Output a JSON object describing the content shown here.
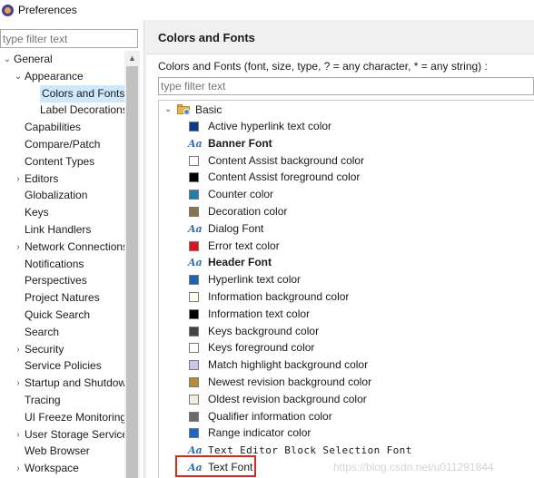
{
  "window": {
    "title": "Preferences"
  },
  "left": {
    "filter_placeholder": "type filter text",
    "tree": [
      {
        "label": "General",
        "arrow": "⌄",
        "level": 0
      },
      {
        "label": "Appearance",
        "arrow": "⌄",
        "level": 1
      },
      {
        "label": "Colors and Fonts",
        "arrow": "",
        "level": 2,
        "selected": true
      },
      {
        "label": "Label Decorations",
        "arrow": "",
        "level": 2
      },
      {
        "label": "Capabilities",
        "arrow": "",
        "level": 1
      },
      {
        "label": "Compare/Patch",
        "arrow": "",
        "level": 1
      },
      {
        "label": "Content Types",
        "arrow": "",
        "level": 1
      },
      {
        "label": "Editors",
        "arrow": "›",
        "level": 1
      },
      {
        "label": "Globalization",
        "arrow": "",
        "level": 1
      },
      {
        "label": "Keys",
        "arrow": "",
        "level": 1
      },
      {
        "label": "Link Handlers",
        "arrow": "",
        "level": 1
      },
      {
        "label": "Network Connections",
        "arrow": "›",
        "level": 1
      },
      {
        "label": "Notifications",
        "arrow": "",
        "level": 1
      },
      {
        "label": "Perspectives",
        "arrow": "",
        "level": 1
      },
      {
        "label": "Project Natures",
        "arrow": "",
        "level": 1
      },
      {
        "label": "Quick Search",
        "arrow": "",
        "level": 1
      },
      {
        "label": "Search",
        "arrow": "",
        "level": 1
      },
      {
        "label": "Security",
        "arrow": "›",
        "level": 1
      },
      {
        "label": "Service Policies",
        "arrow": "",
        "level": 1
      },
      {
        "label": "Startup and Shutdown",
        "arrow": "›",
        "level": 1
      },
      {
        "label": "Tracing",
        "arrow": "",
        "level": 1
      },
      {
        "label": "UI Freeze Monitoring",
        "arrow": "",
        "level": 1
      },
      {
        "label": "User Storage Service",
        "arrow": "›",
        "level": 1
      },
      {
        "label": "Web Browser",
        "arrow": "",
        "level": 1
      },
      {
        "label": "Workspace",
        "arrow": "›",
        "level": 1
      }
    ]
  },
  "right": {
    "title": "Colors and Fonts",
    "description": "Colors and Fonts (font, size, type, ? = any character, * = any string) :",
    "filter_placeholder": "type filter text",
    "category": {
      "label": "Basic",
      "icon": "folder-icon"
    },
    "items": [
      {
        "label": "Active hyperlink text color",
        "kind": "color",
        "color": "#0a3b8c"
      },
      {
        "label": "Banner Font",
        "kind": "font",
        "style": "bold"
      },
      {
        "label": "Content Assist background color",
        "kind": "color",
        "color": "#ffffff"
      },
      {
        "label": "Content Assist foreground color",
        "kind": "color",
        "color": "#000000"
      },
      {
        "label": "Counter color",
        "kind": "color",
        "color": "#1f7fa8"
      },
      {
        "label": "Decoration color",
        "kind": "color",
        "color": "#8a7449"
      },
      {
        "label": "Dialog Font",
        "kind": "font",
        "style": "normal"
      },
      {
        "label": "Error text color",
        "kind": "color",
        "color": "#e01414"
      },
      {
        "label": "Header Font",
        "kind": "font",
        "style": "bold"
      },
      {
        "label": "Hyperlink text color",
        "kind": "color",
        "color": "#1b63b5"
      },
      {
        "label": "Information background color",
        "kind": "color",
        "color": "#fffff0"
      },
      {
        "label": "Information text color",
        "kind": "color",
        "color": "#000000"
      },
      {
        "label": "Keys background color",
        "kind": "color",
        "color": "#444444"
      },
      {
        "label": "Keys foreground color",
        "kind": "color",
        "color": "#ffffff"
      },
      {
        "label": "Match highlight background color",
        "kind": "color",
        "color": "#c8c8ea"
      },
      {
        "label": "Newest revision background color",
        "kind": "color",
        "color": "#b88a3a"
      },
      {
        "label": "Oldest revision background color",
        "kind": "color",
        "color": "#f2ecdf"
      },
      {
        "label": "Qualifier information color",
        "kind": "color",
        "color": "#6b6b6b"
      },
      {
        "label": "Range indicator color",
        "kind": "color",
        "color": "#1a68c4"
      },
      {
        "label": "Text Editor Block Selection Font",
        "kind": "font",
        "style": "mono"
      },
      {
        "label": "Text Font",
        "kind": "font",
        "style": "normal"
      }
    ]
  },
  "watermark": "https://blog.csdn.net/u011291844",
  "accent": {
    "selection": "#cde8ff",
    "highlight": "#d9281e"
  }
}
